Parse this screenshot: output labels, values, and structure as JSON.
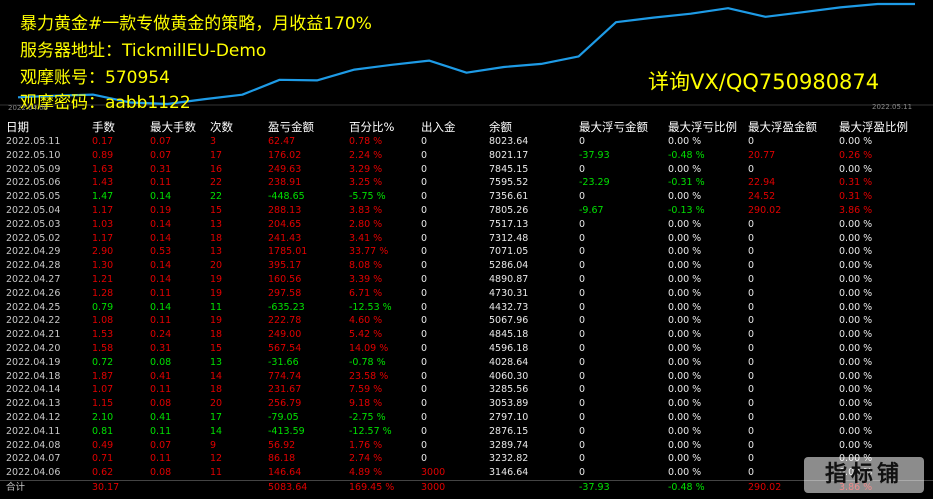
{
  "overlay": {
    "title": "暴力黄金#一款专做黄金的策略，月收益170%",
    "server": "服务器地址：TickmillEU-Demo",
    "account": "观摩账号：570954",
    "password": "观摩密码：aabb1122",
    "contact": "详询VX/QQ750980874"
  },
  "equity_chart": {
    "date_start": "2022.04.06",
    "date_end": "2022.05.11",
    "line_color": "#1e9be6",
    "equity_values": [
      3146.64,
      3232.82,
      3289.74,
      2876.15,
      2797.1,
      3053.89,
      3285.56,
      4060.3,
      4028.64,
      4596.18,
      4845.18,
      5067.96,
      4432.73,
      4730.31,
      4890.87,
      5286.04,
      7071.05,
      7312.48,
      7517.13,
      7805.26,
      7356.61,
      7595.52,
      7845.15,
      8021.17,
      8023.64
    ]
  },
  "colors": {
    "profit": "#e00000",
    "loss": "#00e000",
    "overlay_text": "#ffff00"
  },
  "table": {
    "headers": [
      "日期",
      "手数",
      "最大手数",
      "次数",
      "盈亏金额",
      "百分比%",
      "出入金",
      "余额",
      "最大浮亏金额",
      "最大浮亏比例",
      "最大浮盈金额",
      "最大浮盈比例"
    ],
    "rows": [
      [
        "2022.05.11",
        "0.17",
        "0.07",
        "3",
        "62.47",
        "0.78 %",
        "0",
        "8023.64",
        "0",
        "0.00 %",
        "0",
        "0.00 %"
      ],
      [
        "2022.05.10",
        "0.89",
        "0.07",
        "17",
        "176.02",
        "2.24 %",
        "0",
        "8021.17",
        "-37.93",
        "-0.48 %",
        "20.77",
        "0.26 %"
      ],
      [
        "2022.05.09",
        "1.63",
        "0.31",
        "16",
        "249.63",
        "3.29 %",
        "0",
        "7845.15",
        "0",
        "0.00 %",
        "0",
        "0.00 %"
      ],
      [
        "2022.05.06",
        "1.43",
        "0.11",
        "22",
        "238.91",
        "3.25 %",
        "0",
        "7595.52",
        "-23.29",
        "-0.31 %",
        "22.94",
        "0.31 %"
      ],
      [
        "2022.05.05",
        "1.47",
        "0.14",
        "22",
        "-448.65",
        "-5.75 %",
        "0",
        "7356.61",
        "0",
        "0.00 %",
        "24.52",
        "0.31 %"
      ],
      [
        "2022.05.04",
        "1.17",
        "0.19",
        "15",
        "288.13",
        "3.83 %",
        "0",
        "7805.26",
        "-9.67",
        "-0.13 %",
        "290.02",
        "3.86 %"
      ],
      [
        "2022.05.03",
        "1.03",
        "0.14",
        "13",
        "204.65",
        "2.80 %",
        "0",
        "7517.13",
        "0",
        "0.00 %",
        "0",
        "0.00 %"
      ],
      [
        "2022.05.02",
        "1.17",
        "0.14",
        "18",
        "241.43",
        "3.41 %",
        "0",
        "7312.48",
        "0",
        "0.00 %",
        "0",
        "0.00 %"
      ],
      [
        "2022.04.29",
        "2.90",
        "0.53",
        "13",
        "1785.01",
        "33.77 %",
        "0",
        "7071.05",
        "0",
        "0.00 %",
        "0",
        "0.00 %"
      ],
      [
        "2022.04.28",
        "1.30",
        "0.14",
        "20",
        "395.17",
        "8.08 %",
        "0",
        "5286.04",
        "0",
        "0.00 %",
        "0",
        "0.00 %"
      ],
      [
        "2022.04.27",
        "1.21",
        "0.14",
        "19",
        "160.56",
        "3.39 %",
        "0",
        "4890.87",
        "0",
        "0.00 %",
        "0",
        "0.00 %"
      ],
      [
        "2022.04.26",
        "1.28",
        "0.11",
        "19",
        "297.58",
        "6.71 %",
        "0",
        "4730.31",
        "0",
        "0.00 %",
        "0",
        "0.00 %"
      ],
      [
        "2022.04.25",
        "0.79",
        "0.14",
        "11",
        "-635.23",
        "-12.53 %",
        "0",
        "4432.73",
        "0",
        "0.00 %",
        "0",
        "0.00 %"
      ],
      [
        "2022.04.22",
        "1.08",
        "0.11",
        "19",
        "222.78",
        "4.60 %",
        "0",
        "5067.96",
        "0",
        "0.00 %",
        "0",
        "0.00 %"
      ],
      [
        "2022.04.21",
        "1.53",
        "0.24",
        "18",
        "249.00",
        "5.42 %",
        "0",
        "4845.18",
        "0",
        "0.00 %",
        "0",
        "0.00 %"
      ],
      [
        "2022.04.20",
        "1.58",
        "0.31",
        "15",
        "567.54",
        "14.09 %",
        "0",
        "4596.18",
        "0",
        "0.00 %",
        "0",
        "0.00 %"
      ],
      [
        "2022.04.19",
        "0.72",
        "0.08",
        "13",
        "-31.66",
        "-0.78 %",
        "0",
        "4028.64",
        "0",
        "0.00 %",
        "0",
        "0.00 %"
      ],
      [
        "2022.04.18",
        "1.87",
        "0.41",
        "14",
        "774.74",
        "23.58 %",
        "0",
        "4060.30",
        "0",
        "0.00 %",
        "0",
        "0.00 %"
      ],
      [
        "2022.04.14",
        "1.07",
        "0.11",
        "18",
        "231.67",
        "7.59 %",
        "0",
        "3285.56",
        "0",
        "0.00 %",
        "0",
        "0.00 %"
      ],
      [
        "2022.04.13",
        "1.15",
        "0.08",
        "20",
        "256.79",
        "9.18 %",
        "0",
        "3053.89",
        "0",
        "0.00 %",
        "0",
        "0.00 %"
      ],
      [
        "2022.04.12",
        "2.10",
        "0.41",
        "17",
        "-79.05",
        "-2.75 %",
        "0",
        "2797.10",
        "0",
        "0.00 %",
        "0",
        "0.00 %"
      ],
      [
        "2022.04.11",
        "0.81",
        "0.11",
        "14",
        "-413.59",
        "-12.57 %",
        "0",
        "2876.15",
        "0",
        "0.00 %",
        "0",
        "0.00 %"
      ],
      [
        "2022.04.08",
        "0.49",
        "0.07",
        "9",
        "56.92",
        "1.76 %",
        "0",
        "3289.74",
        "0",
        "0.00 %",
        "0",
        "0.00 %"
      ],
      [
        "2022.04.07",
        "0.71",
        "0.11",
        "12",
        "86.18",
        "2.74 %",
        "0",
        "3232.82",
        "0",
        "0.00 %",
        "0",
        "0.00 %"
      ],
      [
        "2022.04.06",
        "0.62",
        "0.08",
        "11",
        "146.64",
        "4.89 %",
        "3000",
        "3146.64",
        "0",
        "0.00 %",
        "0",
        "0.00 %"
      ]
    ],
    "total": [
      "合计",
      "30.17",
      "",
      "",
      "5083.64",
      "169.45 %",
      "3000",
      "",
      "-37.93",
      "-0.48 %",
      "290.02",
      "3.86 %"
    ]
  },
  "watermark": "指标铺"
}
